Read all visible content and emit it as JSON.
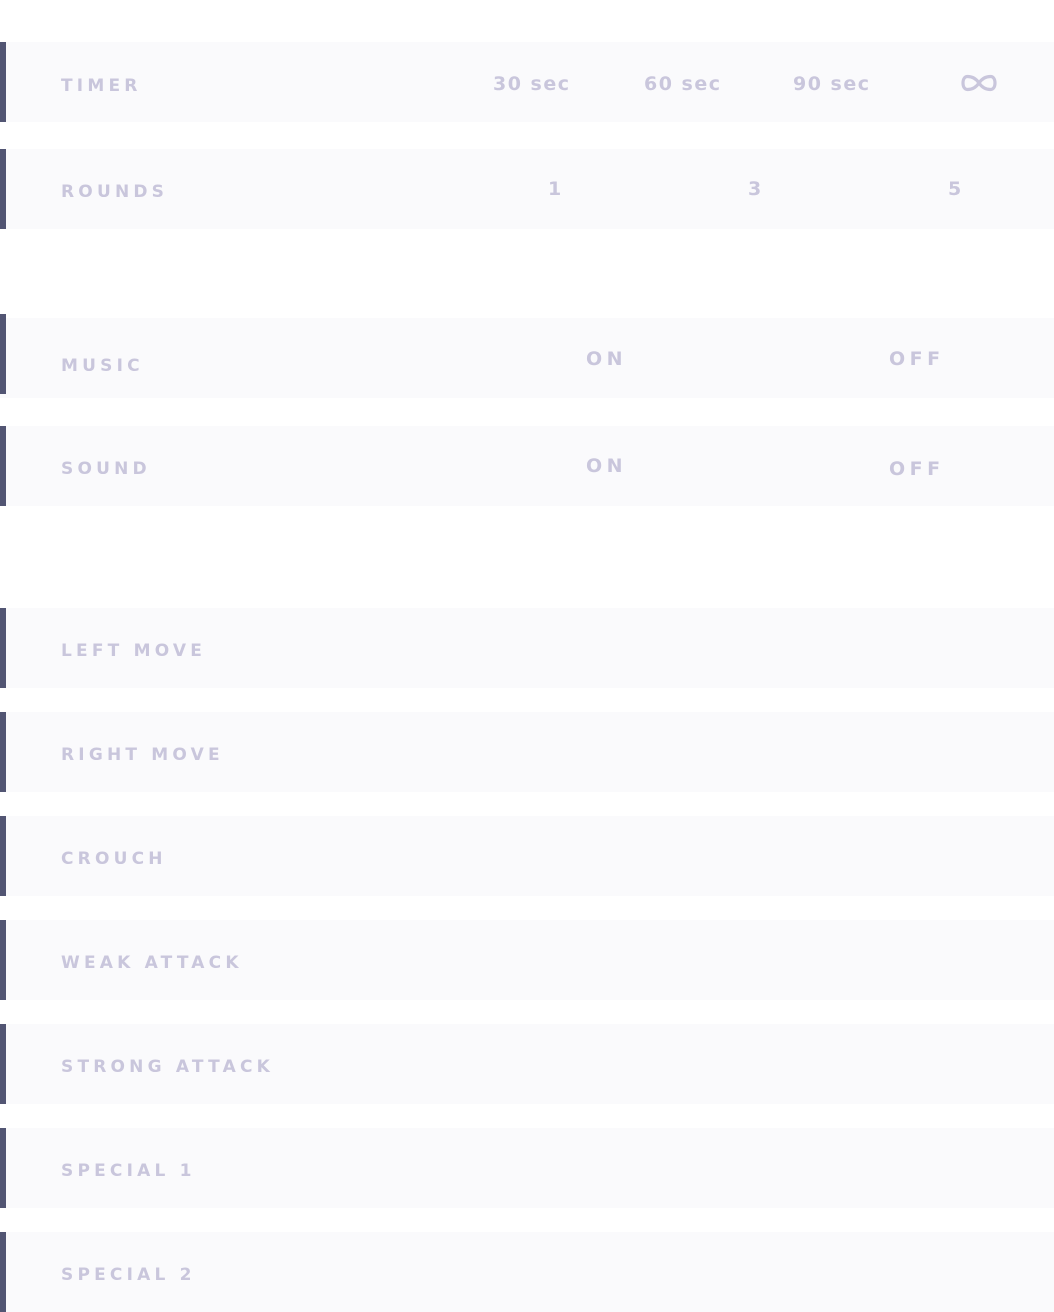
{
  "settings": {
    "timer": {
      "label": "TIMER",
      "options": [
        "30 sec",
        "60 sec",
        "90 sec"
      ],
      "infinity_icon": "infinity-icon"
    },
    "rounds": {
      "label": "ROUNDS",
      "options": [
        "1",
        "3",
        "5"
      ]
    },
    "music": {
      "label": "MUSIC",
      "on": "ON",
      "off": "OFF"
    },
    "sound": {
      "label": "SOUND",
      "on": "ON",
      "off": "OFF"
    }
  },
  "controls": [
    {
      "label": "LEFT MOVE"
    },
    {
      "label": "RIGHT MOVE"
    },
    {
      "label": "CROUCH"
    },
    {
      "label": "WEAK ATTACK"
    },
    {
      "label": "STRONG ATTACK"
    },
    {
      "label": "SPECIAL 1"
    },
    {
      "label": "SPECIAL 2"
    }
  ],
  "colors": {
    "row_background": "#fafafc",
    "accent_bar": "#525573",
    "text": "#c9c6dc"
  }
}
